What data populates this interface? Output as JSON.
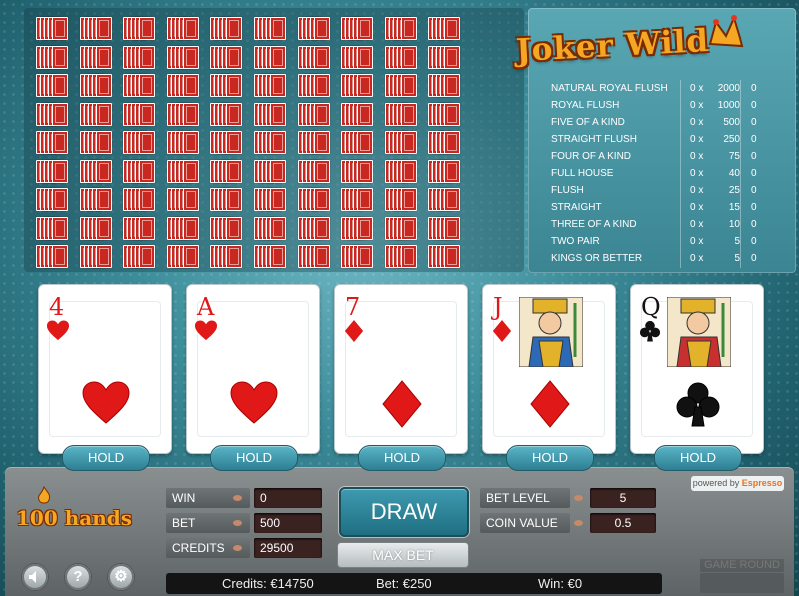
{
  "title": "Joker Wild",
  "hands_label": "100 hands",
  "paytable": [
    {
      "hand": "NATURAL ROYAL FLUSH",
      "mult": "0 x",
      "pay": "2000",
      "win": "0"
    },
    {
      "hand": "ROYAL FLUSH",
      "mult": "0 x",
      "pay": "1000",
      "win": "0"
    },
    {
      "hand": "FIVE OF A KIND",
      "mult": "0 x",
      "pay": "500",
      "win": "0"
    },
    {
      "hand": "STRAIGHT FLUSH",
      "mult": "0 x",
      "pay": "250",
      "win": "0"
    },
    {
      "hand": "FOUR OF A KIND",
      "mult": "0 x",
      "pay": "75",
      "win": "0"
    },
    {
      "hand": "FULL HOUSE",
      "mult": "0 x",
      "pay": "40",
      "win": "0"
    },
    {
      "hand": "FLUSH",
      "mult": "0 x",
      "pay": "25",
      "win": "0"
    },
    {
      "hand": "STRAIGHT",
      "mult": "0 x",
      "pay": "15",
      "win": "0"
    },
    {
      "hand": "THREE OF A KIND",
      "mult": "0 x",
      "pay": "10",
      "win": "0"
    },
    {
      "hand": "TWO PAIR",
      "mult": "0 x",
      "pay": "5",
      "win": "0"
    },
    {
      "hand": "KINGS OR BETTER",
      "mult": "0 x",
      "pay": "5",
      "win": "0"
    }
  ],
  "cards": [
    {
      "rank": "4",
      "suit": "heart",
      "color": "red",
      "face": false
    },
    {
      "rank": "A",
      "suit": "heart",
      "color": "red",
      "face": false
    },
    {
      "rank": "7",
      "suit": "diamond",
      "color": "red",
      "face": false
    },
    {
      "rank": "J",
      "suit": "diamond",
      "color": "red",
      "face": true
    },
    {
      "rank": "Q",
      "suit": "club",
      "color": "black",
      "face": true
    }
  ],
  "hold_label": "HOLD",
  "fields": {
    "win_label": "WIN",
    "win_value": "0",
    "bet_label": "BET",
    "bet_value": "500",
    "credits_label": "CREDITS",
    "credits_value": "29500",
    "bet_level_label": "BET LEVEL",
    "bet_level_value": "5",
    "coin_value_label": "COIN VALUE",
    "coin_value_value": "0.5"
  },
  "draw_label": "DRAW",
  "max_bet_label": "MAX BET",
  "powered_by": "powered by",
  "powered_brand": "Espresso",
  "game_round_label": "GAME ROUND",
  "status": {
    "credits": "Credits: €14750",
    "bet": "Bet: €250",
    "win": "Win: €0"
  },
  "icons": {
    "sound": "speaker-icon",
    "help": "question-icon",
    "settings": "gear-icon"
  },
  "colors": {
    "card_back": "#c8281f",
    "logo": "#f5a623",
    "accent": "#2d7f93"
  }
}
